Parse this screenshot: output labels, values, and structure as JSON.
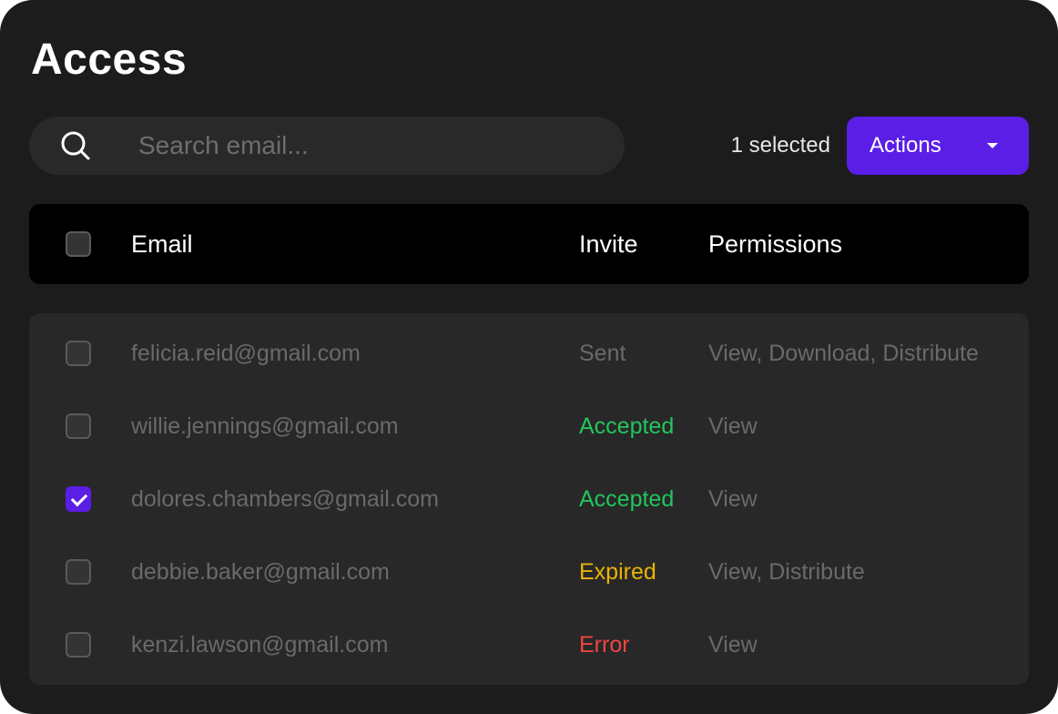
{
  "title": "Access",
  "search": {
    "placeholder": "Search email...",
    "value": ""
  },
  "selection": {
    "count_label": "1 selected"
  },
  "actions_button": {
    "label": "Actions"
  },
  "table": {
    "columns": {
      "email": "Email",
      "invite": "Invite",
      "permissions": "Permissions"
    },
    "header_checkbox": {
      "checked": false
    },
    "rows": [
      {
        "email": "felicia.reid@gmail.com",
        "invite": "Sent",
        "invite_color": "#6a6a6a",
        "permissions": "View, Download, Distribute",
        "checked": false
      },
      {
        "email": "willie.jennings@gmail.com",
        "invite": "Accepted",
        "invite_color": "#22c55e",
        "permissions": "View",
        "checked": false
      },
      {
        "email": "dolores.chambers@gmail.com",
        "invite": "Accepted",
        "invite_color": "#22c55e",
        "permissions": "View",
        "checked": true
      },
      {
        "email": "debbie.baker@gmail.com",
        "invite": "Expired",
        "invite_color": "#eab308",
        "permissions": "View, Distribute",
        "checked": false
      },
      {
        "email": "kenzi.lawson@gmail.com",
        "invite": "Error",
        "invite_color": "#ef4444",
        "permissions": "View",
        "checked": false
      }
    ]
  },
  "colors": {
    "accent": "#5b1ee6",
    "background": "#1c1c1c",
    "accepted": "#22c55e",
    "expired": "#eab308",
    "error": "#ef4444"
  },
  "icons": {
    "search": "search-icon",
    "dropdown": "chevron-down-icon",
    "check": "check-icon"
  }
}
